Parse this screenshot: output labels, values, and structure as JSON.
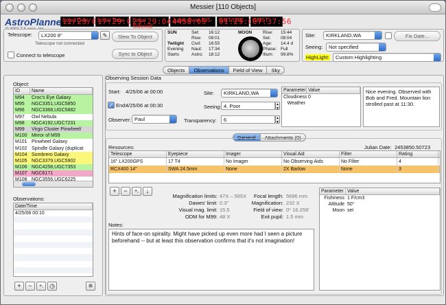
{
  "window": {
    "title": "Messier [110 Objects]"
  },
  "app": {
    "logo": "AstroPlanner",
    "copyright": "© 2002-7 iLanga, Inc."
  },
  "clocks": [
    {
      "label": "Local Date",
      "value": "12/23/07"
    },
    {
      "label": "Local Time",
      "value": "17:29:07"
    },
    {
      "label": "Local Sidereal",
      "value": "23:29:04"
    },
    {
      "label": "Julian Date 245-",
      "value": "4458.05"
    },
    {
      "label": "GMT/UTC",
      "value": "01:29:07"
    },
    {
      "label": "GMST",
      "value": "07:37:56"
    }
  ],
  "telescope": {
    "label": "Telescope:",
    "value": "LX200 8\"",
    "status": "Telescope not connected",
    "slew": "Slew To Object",
    "sync": "Sync to Object",
    "connect": "Connect to telescope"
  },
  "sun": {
    "title": "SUN",
    "rise_l": "Set:",
    "rise_v": "16:12",
    "l2": "Rise:",
    "v2": "08:01",
    "twilight": "Twilight",
    "civil_l": "Civil:",
    "civil_v": "16:55",
    "evening": "Evening",
    "naut_l": "Naut:",
    "naut_v": "17:34",
    "starts": "Starts",
    "astro_l": "Astro:",
    "astro_v": "18:12"
  },
  "moon": {
    "title": "MOON",
    "rise_l": "Rise:",
    "rise_v": "15:44",
    "set_l": "Set:",
    "set_v": "08:04",
    "age_l": "Age:",
    "age_v": "14.4 d",
    "phase_l": "Phase:",
    "phase_v": "Full",
    "illum_l": "Illum:",
    "illum_v": "99.8%"
  },
  "site": {
    "label": "Site:",
    "value": "KIRKLAND,WA",
    "fix": "Fix Date...",
    "seeing_l": "Seeing:",
    "seeing_v": "Not specified",
    "highlight_l": "HighLight:",
    "highlight_v": "Custom Highlighting"
  },
  "main_tabs": [
    "Objects",
    "Observations",
    "Field of View",
    "Sky"
  ],
  "object_list": {
    "label": "Object:",
    "headers": [
      "ID",
      "Name"
    ],
    "rows": [
      {
        "id": "M94",
        "name": "Croc's Eye Galaxy",
        "c": "g"
      },
      {
        "id": "M95",
        "name": "NGC3351,UGC5850",
        "c": "g"
      },
      {
        "id": "M96",
        "name": "NGC3368,UGC5882",
        "c": "g"
      },
      {
        "id": "M97",
        "name": "Owl Nebula",
        "c": ""
      },
      {
        "id": "M98",
        "name": "NGC4192,UGC7231",
        "c": "g"
      },
      {
        "id": "M99",
        "name": "Virgo Cluster Pinwheel/",
        "c": "gr"
      },
      {
        "id": "M100",
        "name": "Mirror of M99",
        "c": "g"
      },
      {
        "id": "M101",
        "name": "Pinwheel Galaxy",
        "c": ""
      },
      {
        "id": "M102",
        "name": "Spindle Galaxy (duplicat",
        "c": ""
      },
      {
        "id": "M104",
        "name": "Sombrero Galaxy",
        "c": "y"
      },
      {
        "id": "M105",
        "name": "NGC3379,UGC5902",
        "c": "y"
      },
      {
        "id": "M106",
        "name": "NGC4258,UGC7353",
        "c": "g"
      },
      {
        "id": "M107",
        "name": "NGC6171",
        "c": "p"
      },
      {
        "id": "M108",
        "name": "NGC3556,UGC6225",
        "c": ""
      }
    ]
  },
  "observations": {
    "label": "Observations:",
    "header": "Date/Time",
    "rows": [
      "4/25/06  00:10"
    ]
  },
  "session": {
    "title": "Observing Session Data",
    "start_l": "Start:",
    "start_v": "4/25/06 at 00:00",
    "end_l": "End:",
    "end_v": "4/25/06 at 00:30",
    "observer_l": "Observer:",
    "observer_v": "Paul",
    "site_l": "Site:",
    "site_v": "KIRKLAND,WA",
    "seeing_l": "Seeing:",
    "seeing_v": "4. Poor",
    "transparency_l": "Transparency:",
    "transparency_v": "6",
    "param_h": "Parameter",
    "value_h": "Value",
    "params": [
      {
        "p": "Cloudiness",
        "v": "0"
      },
      {
        "p": "Weather",
        "v": ""
      }
    ],
    "note": "Nice evening. Observed with Bob and Fred. Mountain lion strolled past at 11:30."
  },
  "sub_tabs": [
    "General",
    "Attachments (0)"
  ],
  "resources": {
    "label": "Resources:",
    "jd_label": "Julian Date:",
    "jd_value": "2453850.50723",
    "headers": [
      "Telescope",
      "Eyepiece",
      "Imager",
      "Visual Aid",
      "Filter",
      "Rating"
    ],
    "rows": [
      [
        "16\" LX200GPS",
        "17 T4",
        "No Imager",
        "No Observing Aids",
        "No Filter",
        "4"
      ],
      [
        "RCX400 14\"",
        "SWA 24.5mm",
        "None",
        "2X Barlow",
        "None",
        "3"
      ]
    ]
  },
  "optics": {
    "mag_limits_l": "Magnification limits:",
    "mag_limits_v": "47X – 565X",
    "dawes_l": "Dawes' limit:",
    "dawes_v": "0.3\"",
    "vis_l": "Visual mag. limit:",
    "vis_v": "15.5",
    "odm_l": "ODM for M99:",
    "odm_v": "48 X",
    "focal_l": "Focal length:",
    "focal_v": "5696 mm",
    "magn_l": "Magnification:",
    "magn_v": "232 X",
    "fov_l": "Field of view:",
    "fov_v": "0° 16.259'",
    "exit_l": "Exit pupil:",
    "exit_v": "1.5 mm"
  },
  "params2": {
    "headers": [
      "Parameter",
      "Value"
    ],
    "rows": [
      [
        "Fishiness",
        "1 F/cm3"
      ],
      [
        "Altitude",
        "50°"
      ],
      [
        "Moon",
        "set"
      ]
    ]
  },
  "notes": {
    "label": "Notes:",
    "text": "Hints of face-on spirality.  Might have picked up even more had I seen a picture beforehand -- but at least this observation confirms that it's not imagination!"
  }
}
